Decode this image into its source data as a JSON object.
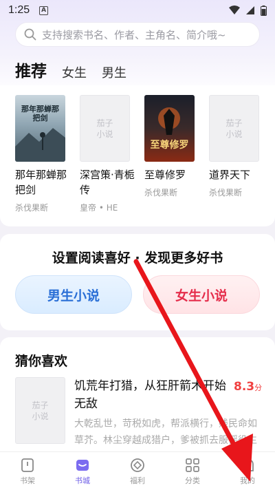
{
  "status_bar": {
    "time": "1:25",
    "notif": "A"
  },
  "search": {
    "placeholder": "支持搜索书名、作者、主角名、简介哦~"
  },
  "tabs": [
    {
      "label": "推荐",
      "active": true
    },
    {
      "label": "女生",
      "active": false
    },
    {
      "label": "男生",
      "active": false
    }
  ],
  "books": [
    {
      "title": "那年那蝉那把剑",
      "author": "杀伐果断",
      "cover": "image",
      "cover_text": "那年那蝉那把剑"
    },
    {
      "title": "深宫策·青栀传",
      "author": "皇帝 • HE",
      "cover": "placeholder",
      "placeholder_line1": "茄子",
      "placeholder_line2": "小说"
    },
    {
      "title": "至尊修罗",
      "author": "杀伐果断",
      "cover": "image",
      "cover_text": "至尊修罗"
    },
    {
      "title": "道界天下",
      "author": "杀伐果断",
      "cover": "placeholder",
      "placeholder_line1": "茄子",
      "placeholder_line2": "小说"
    }
  ],
  "preference": {
    "title": "设置阅读喜好 · 发现更多好书",
    "male_label": "男生小说",
    "female_label": "女生小说"
  },
  "guess": {
    "section_title": "猜你喜欢",
    "placeholder_line1": "茄子",
    "placeholder_line2": "小说",
    "book_title": "饥荒年打猎，从狂肝箭术开始无敌",
    "score": "8.3",
    "score_unit": "分",
    "description": "大乾乱世，苛税如虎，帮派横行，贱民命如草芥。林尘穿越成猎户，爹被抓去服徭役生死未卜，家里一贫如洗，还被豪强觊觎家中妹子……"
  },
  "bottom_nav": [
    {
      "label": "书架",
      "icon": "bookshelf-icon",
      "active": false
    },
    {
      "label": "书城",
      "icon": "bookstore-icon",
      "active": true
    },
    {
      "label": "福利",
      "icon": "welfare-icon",
      "active": false
    },
    {
      "label": "分类",
      "icon": "category-icon",
      "active": false
    },
    {
      "label": "我的",
      "icon": "profile-icon",
      "active": false
    }
  ],
  "colors": {
    "accent": "#6b5be6",
    "score": "#f04040",
    "male": "#2a6fd6",
    "female": "#e52d4b",
    "arrow": "#e8161b"
  }
}
